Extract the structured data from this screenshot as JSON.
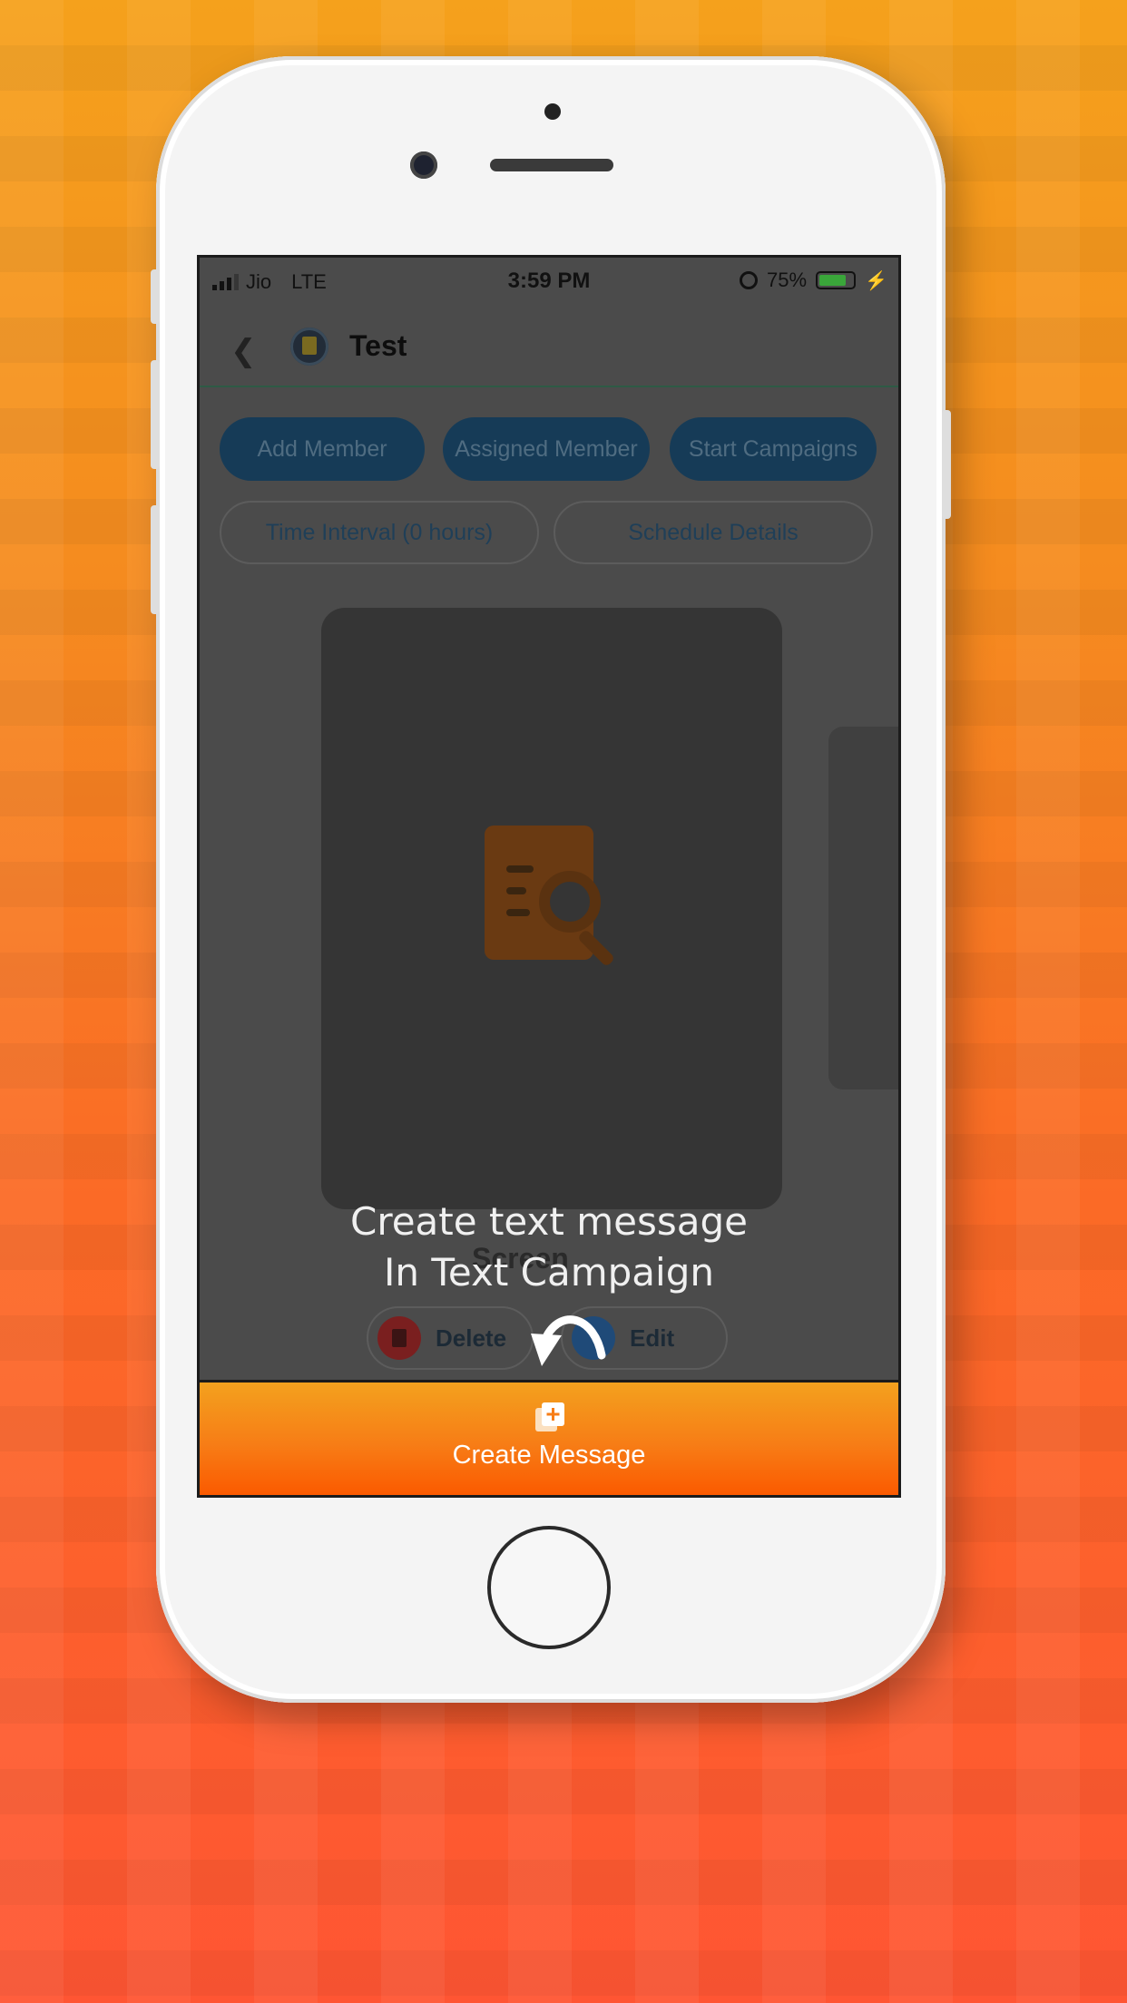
{
  "status_bar": {
    "carrier": "Jio",
    "network": "LTE",
    "time": "3:59 PM",
    "battery": "75%"
  },
  "header": {
    "title": "Test"
  },
  "actions": {
    "add_member": "Add Member",
    "assigned_member": "Assigned Member",
    "start_campaigns": "Start Campaigns",
    "time_interval": "Time Interval (0 hours)",
    "schedule_details": "Schedule Details"
  },
  "item": {
    "label": "Screen"
  },
  "item_actions": {
    "delete": "Delete",
    "edit": "Edit"
  },
  "tutorial": {
    "line1": "Create text message",
    "line2": "In Text Campaign"
  },
  "bottom_bar": {
    "label": "Create Message"
  },
  "icons": {
    "back": "chevron-left-icon",
    "avatar": "app-avatar-icon",
    "empty": "document-search-icon",
    "delete": "trash-icon",
    "edit": "pencil-icon",
    "create": "add-copy-icon",
    "arrow": "curved-arrow-icon"
  },
  "colors": {
    "accent": "#f77d16",
    "dark_pill": "#163b57"
  }
}
